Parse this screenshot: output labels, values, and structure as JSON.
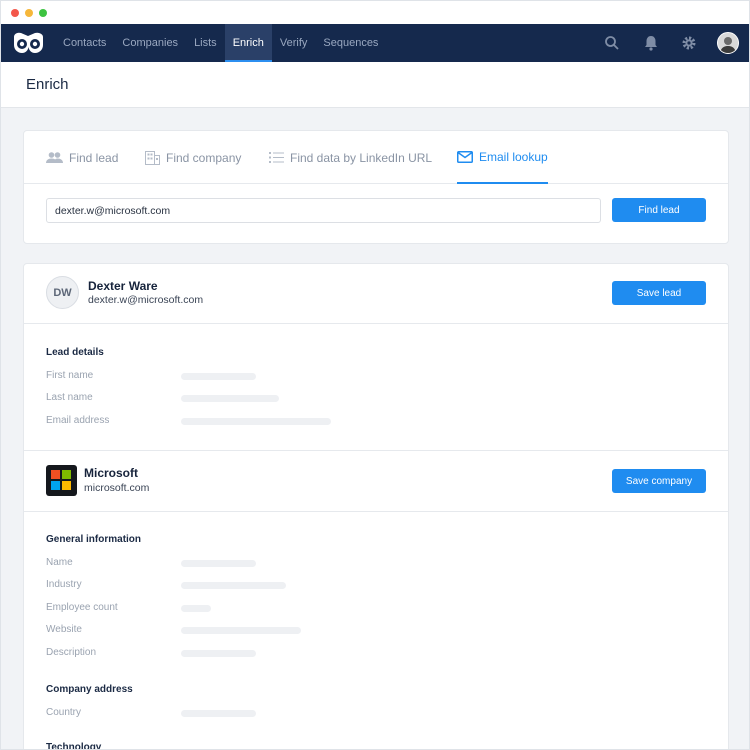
{
  "nav": {
    "items": [
      {
        "label": "Contacts",
        "active": false
      },
      {
        "label": "Companies",
        "active": false
      },
      {
        "label": "Lists",
        "active": false
      },
      {
        "label": "Enrich",
        "active": true
      },
      {
        "label": "Verify",
        "active": false
      },
      {
        "label": "Sequences",
        "active": false
      }
    ],
    "icons": [
      "search-icon",
      "bell-icon",
      "gear-icon",
      "user-avatar"
    ],
    "accent_color": "#15294d"
  },
  "page": {
    "title": "Enrich"
  },
  "tabs": [
    {
      "label": "Find lead",
      "icon": "people-icon",
      "active": false
    },
    {
      "label": "Find company",
      "icon": "building-icon",
      "active": false
    },
    {
      "label": "Find data by LinkedIn URL",
      "icon": "list-icon",
      "active": false
    },
    {
      "label": "Email lookup",
      "icon": "mail-icon",
      "active": true
    }
  ],
  "search": {
    "value": "dexter.w@microsoft.com",
    "button": "Find lead"
  },
  "lead": {
    "initials": "DW",
    "name": "Dexter Ware",
    "email": "dexter.w@microsoft.com",
    "save_button": "Save lead",
    "details_title": "Lead details",
    "fields": [
      "First name",
      "Last name",
      "Email address"
    ]
  },
  "company": {
    "name": "Microsoft",
    "domain": "microsoft.com",
    "save_button": "Save company",
    "general_title": "General information",
    "general_fields": [
      "Name",
      "Industry",
      "Employee count",
      "Website",
      "Description"
    ],
    "address_title": "Company address",
    "address_fields": [
      "Country"
    ],
    "technology_title": "Technology"
  },
  "colors": {
    "primary": "#1f8cf0",
    "navbar": "#15294d",
    "skeleton": "#eef0f3"
  }
}
